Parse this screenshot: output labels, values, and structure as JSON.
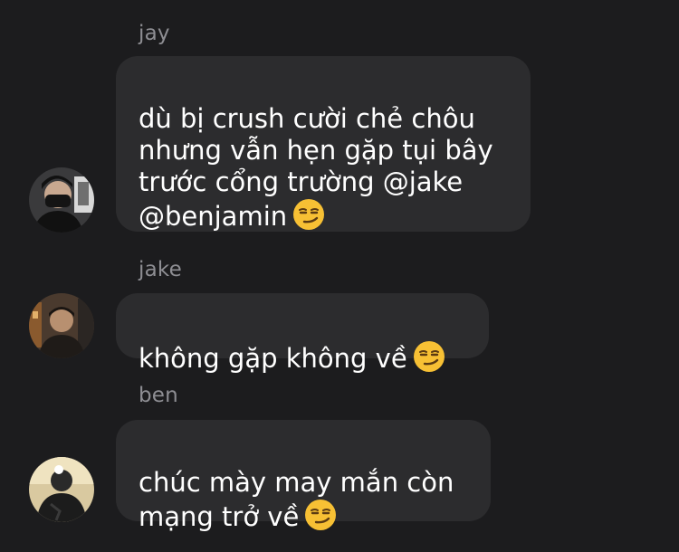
{
  "messages": [
    {
      "sender": "jay",
      "text": "dù bị crush cười chẻ chôu\nnhưng vẫn hẹn gặp tụi bây\ntrước cổng trường @jake\n@benjamin",
      "emoji": "smirking-face-emoji"
    },
    {
      "sender": "jake",
      "text": "không gặp không về",
      "emoji": "smirking-face-emoji"
    },
    {
      "sender": "ben",
      "text": "chúc mày may mắn còn\nmạng trở về",
      "emoji": "smirking-face-emoji"
    }
  ],
  "colors": {
    "background": "#1c1c1e",
    "bubble": "#2c2c2e",
    "sender_name": "#8e8e93",
    "text": "#ffffff"
  }
}
